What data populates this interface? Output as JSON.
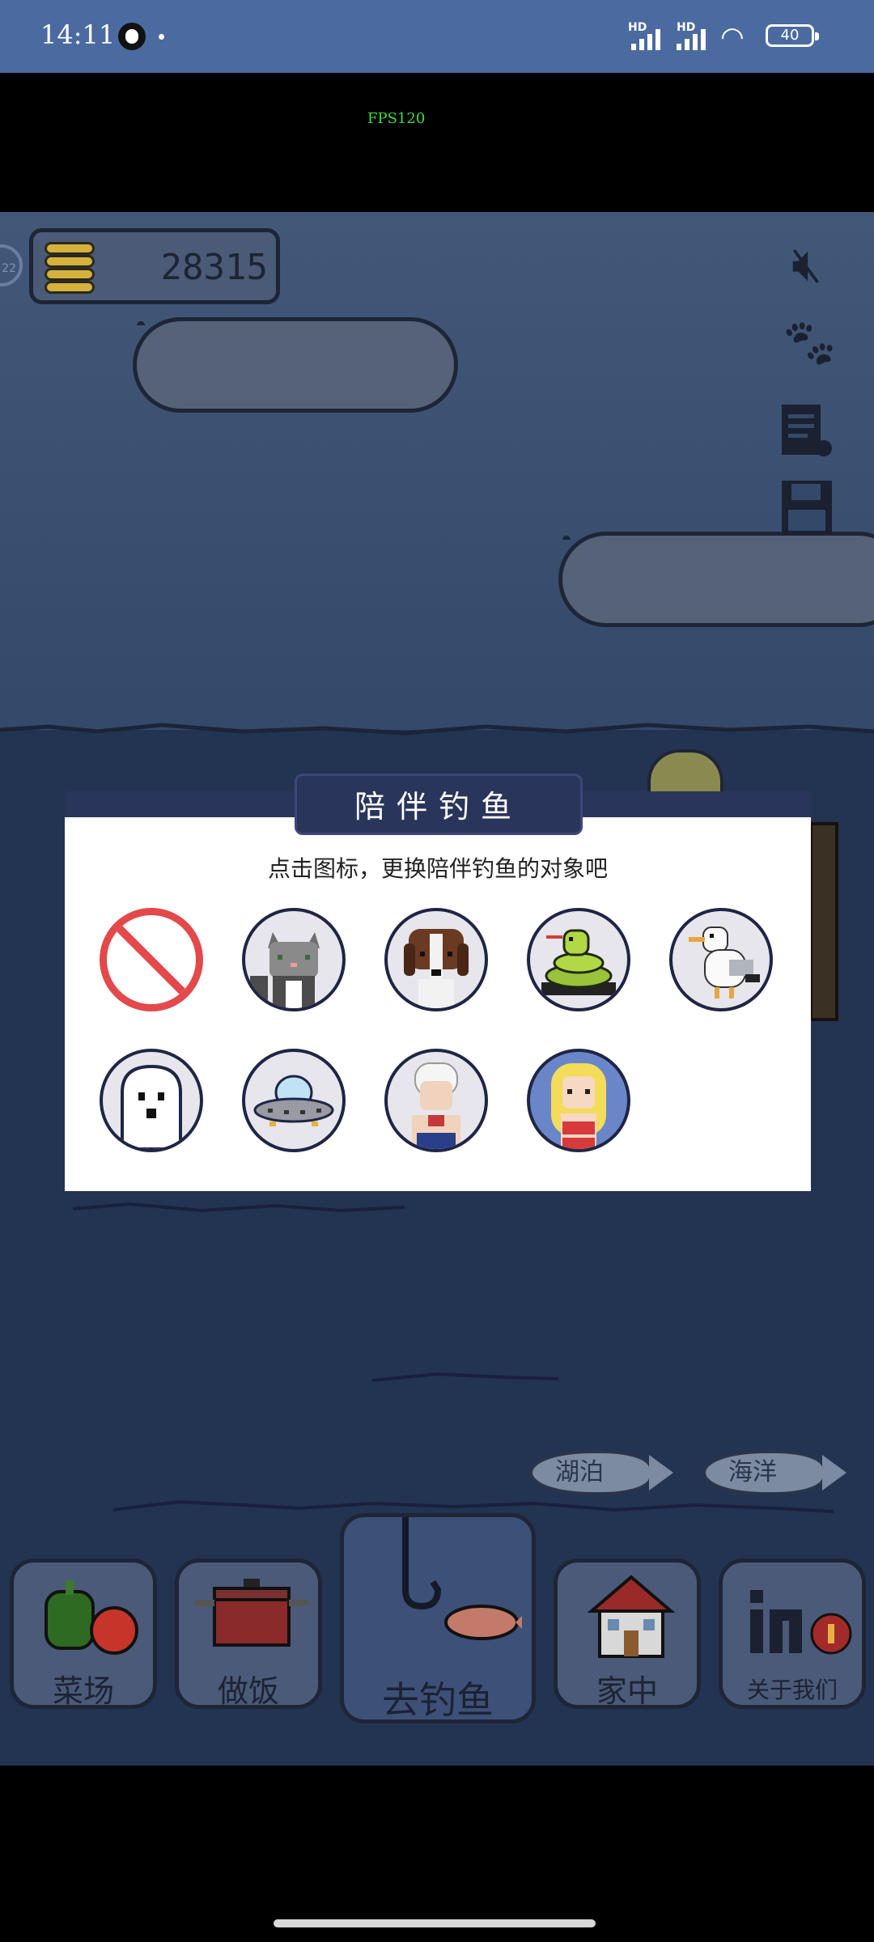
{
  "status_bar": {
    "time": "14:11",
    "network_1": "HD",
    "network_2": "HD",
    "battery": "40"
  },
  "fps": "FPS120",
  "hud": {
    "coins": "28315",
    "level_badge": "22"
  },
  "dialog": {
    "title": "陪伴钓鱼",
    "subtitle": "点击图标，更换陪伴钓鱼的对象吧",
    "companions": [
      {
        "name": "none",
        "icon": "no-companion-icon"
      },
      {
        "name": "cat",
        "icon": "cat-icon"
      },
      {
        "name": "dog",
        "icon": "dog-icon"
      },
      {
        "name": "snake",
        "icon": "snake-icon"
      },
      {
        "name": "seagull",
        "icon": "seagull-icon"
      },
      {
        "name": "ghost",
        "icon": "ghost-icon"
      },
      {
        "name": "ufo",
        "icon": "ufo-icon"
      },
      {
        "name": "old man",
        "icon": "old-man-icon"
      },
      {
        "name": "mermaid",
        "icon": "blonde-girl-icon"
      }
    ]
  },
  "fish_tags": {
    "lake": "湖泊",
    "ocean": "海洋"
  },
  "nav": {
    "farm": "菜场",
    "cook": "做饭",
    "fish": "去钓鱼",
    "home": "家中",
    "about": "关于我们"
  },
  "colors": {
    "status_bar": "#4a6aa0",
    "dialog_header": "#2a355c",
    "no_companion_red": "#e3494a"
  }
}
